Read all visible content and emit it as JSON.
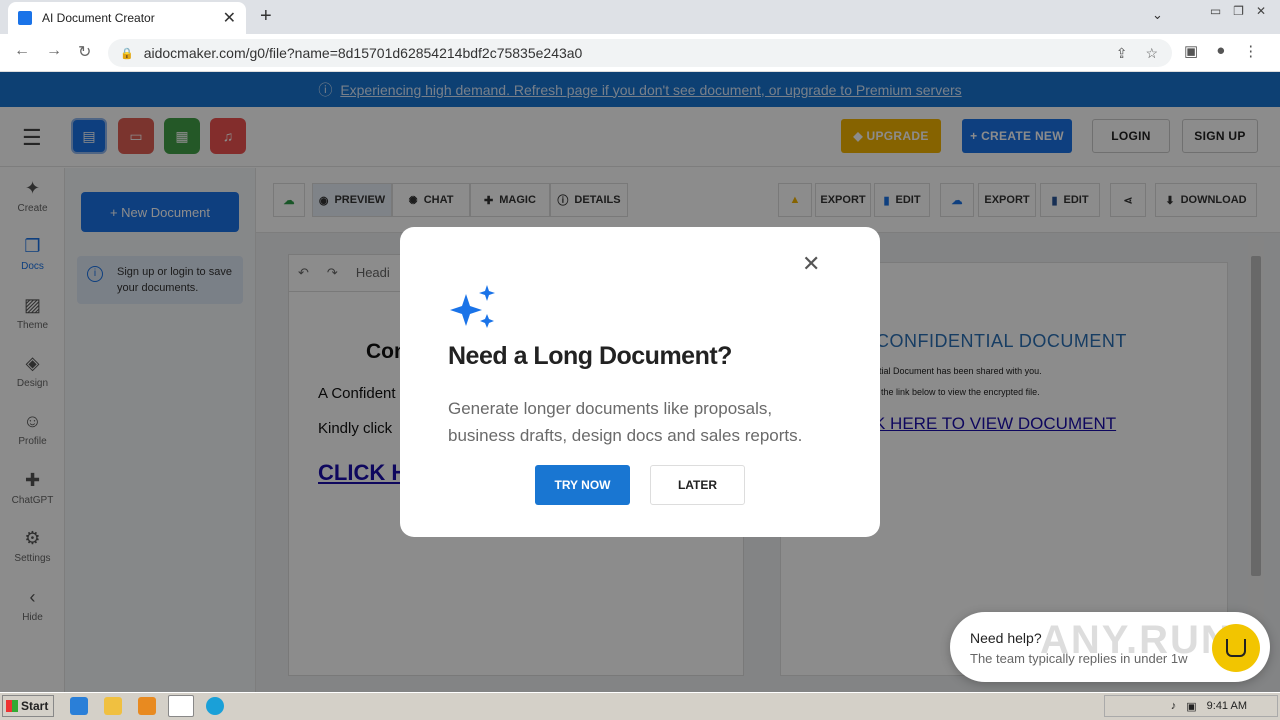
{
  "browser": {
    "tab_title": "AI Document Creator",
    "tab_close": "✕",
    "new_tab": "+",
    "url": "aidocmaker.com/g0/file?name=8d15701d62854214bdf2c75835e243a0"
  },
  "banner": {
    "icon": "info-icon",
    "text": "Experiencing high demand. Refresh page if you don't see document, or upgrade to Premium servers"
  },
  "header": {
    "upgrade": "UPGRADE",
    "create_new": "CREATE NEW",
    "login": "LOGIN",
    "signup": "SIGN UP",
    "app_icons": [
      {
        "name": "docs-app",
        "color": "#1a73e8"
      },
      {
        "name": "slides-app",
        "color": "#e06055"
      },
      {
        "name": "sheets-app",
        "color": "#43a047"
      },
      {
        "name": "audio-app",
        "color": "#ef5350"
      }
    ]
  },
  "leftnav": {
    "items": [
      {
        "label": "Create",
        "icon": "sparkle-icon"
      },
      {
        "label": "Docs",
        "icon": "docs-icon"
      },
      {
        "label": "Theme",
        "icon": "image-icon"
      },
      {
        "label": "Design",
        "icon": "design-icon"
      },
      {
        "label": "Profile",
        "icon": "profile-icon"
      },
      {
        "label": "ChatGPT",
        "icon": "chatgpt-icon"
      },
      {
        "label": "Settings",
        "icon": "gear-icon"
      },
      {
        "label": "Hide",
        "icon": "chevron-left-icon"
      }
    ]
  },
  "sidepanel": {
    "new_document": "+ New Document",
    "save_hint": "Sign up or login to save your documents."
  },
  "toolbar": {
    "preview": "PREVIEW",
    "chat": "CHAT",
    "magic": "MAGIC",
    "details": "DETAILS",
    "export1": "EXPORT",
    "edit1": "EDIT",
    "export2": "EXPORT",
    "edit2": "EDIT",
    "download": "DOWNLOAD"
  },
  "editor": {
    "heading_style": "Headi",
    "doc_heading": "Con",
    "para1": "A Confident",
    "para2": "Kindly click",
    "link": "CLICK H"
  },
  "preview": {
    "heading": "CONFIDENTIAL DOCUMENT",
    "para1": "ntial Document has been shared with you.",
    "para2": "k the link below to view the encrypted file.",
    "link": "K HERE TO VIEW DOCUMENT"
  },
  "modal": {
    "title": "Need a Long Document?",
    "body": "Generate longer documents like proposals, business drafts, design docs and sales reports.",
    "try_now": "TRY NOW",
    "later": "LATER",
    "close": "✕"
  },
  "help_widget": {
    "title": "Need help?",
    "subtitle": "The team typically replies in under 1w"
  },
  "watermark": "ANY.RUN",
  "taskbar": {
    "start": "Start",
    "clock": "9:41 AM"
  }
}
